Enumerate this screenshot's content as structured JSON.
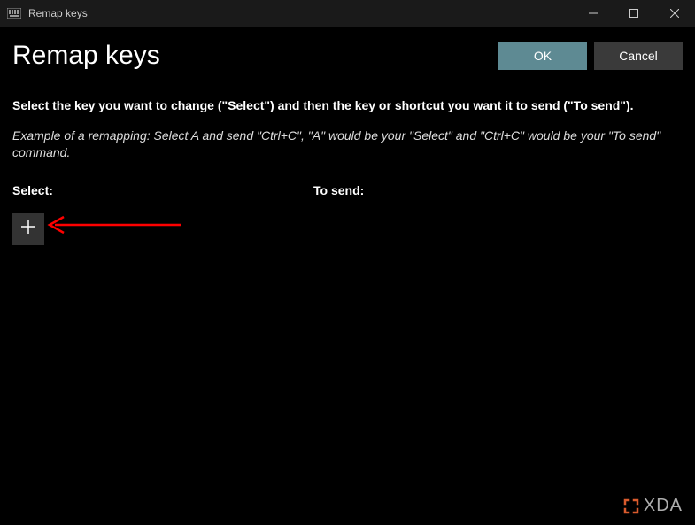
{
  "titlebar": {
    "title": "Remap keys"
  },
  "header": {
    "page_title": "Remap keys",
    "ok_label": "OK",
    "cancel_label": "Cancel"
  },
  "content": {
    "instruction": "Select the key you want to change (\"Select\") and then the key or shortcut you want it to send (\"To send\").",
    "example": "Example of a remapping: Select A and send \"Ctrl+C\", \"A\" would be your \"Select\" and \"Ctrl+C\" would be your \"To send\" command.",
    "select_label": "Select:",
    "to_send_label": "To send:"
  },
  "watermark": {
    "text": "XDA"
  }
}
